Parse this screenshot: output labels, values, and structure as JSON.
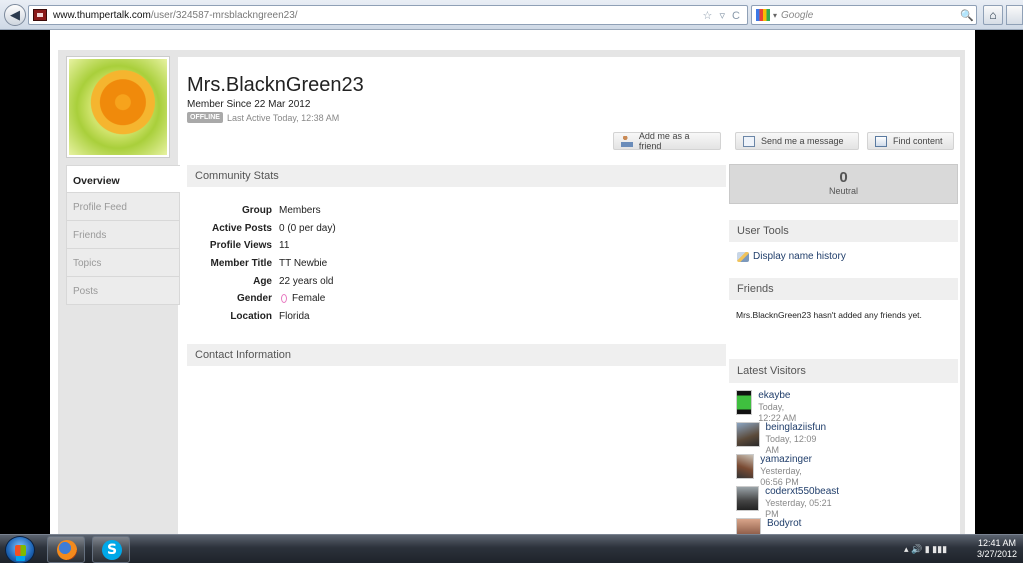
{
  "browser": {
    "url_domain": "www.thumpertalk.com",
    "url_path": "/user/324587-mrsblackngreen23/",
    "search_placeholder": "Google",
    "back_glyph": "◀",
    "url_icons": "☆ ▿ C",
    "search_glyph": "🔍",
    "home_glyph": "⌂"
  },
  "profile": {
    "name": "Mrs.BlacknGreen23",
    "member_since": "Member Since 22 Mar 2012",
    "status_badge": "OFFLINE",
    "last_active": "Last Active Today, 12:38 AM"
  },
  "actions": {
    "add_friend": "Add me as a friend",
    "send_message": "Send me a message",
    "find_content": "Find content"
  },
  "tabs": [
    {
      "label": "Overview"
    },
    {
      "label": "Profile Feed"
    },
    {
      "label": "Friends"
    },
    {
      "label": "Topics"
    },
    {
      "label": "Posts"
    }
  ],
  "community_stats": {
    "title": "Community Stats",
    "rows": [
      {
        "label": "Group",
        "value": "Members"
      },
      {
        "label": "Active Posts",
        "value": "0 (0 per day)"
      },
      {
        "label": "Profile Views",
        "value": "11"
      },
      {
        "label": "Member Title",
        "value": "TT Newbie"
      },
      {
        "label": "Age",
        "value": "22 years old"
      },
      {
        "label": "Gender",
        "value": "Female"
      },
      {
        "label": "Location",
        "value": "Florida"
      }
    ]
  },
  "contact": {
    "title": "Contact Information"
  },
  "reputation": {
    "value": "0",
    "label": "Neutral"
  },
  "user_tools": {
    "title": "User Tools",
    "link": "Display name history"
  },
  "friends": {
    "title": "Friends",
    "text": "Mrs.BlacknGreen23 hasn't added any friends yet."
  },
  "latest_visitors": {
    "title": "Latest Visitors",
    "items": [
      {
        "name": "ekaybe",
        "time": "Today, 12:22 AM"
      },
      {
        "name": "beinglaziisfun",
        "time": "Today, 12:09 AM"
      },
      {
        "name": "yamazinger",
        "time": "Yesterday, 06:56 PM"
      },
      {
        "name": "coderxt550beast",
        "time": "Yesterday, 05:21 PM"
      },
      {
        "name": "Bodyrot",
        "time": ""
      }
    ]
  },
  "taskbar": {
    "clock_time": "12:41 AM",
    "clock_date": "3/27/2012",
    "skype_letter": "S",
    "tray_glyphs": "▴ 🔊 ▮ ▮▮▮"
  },
  "colors": {
    "link": "#203e6b",
    "badge": "#a9a9a9",
    "section_bg": "#efefef"
  }
}
